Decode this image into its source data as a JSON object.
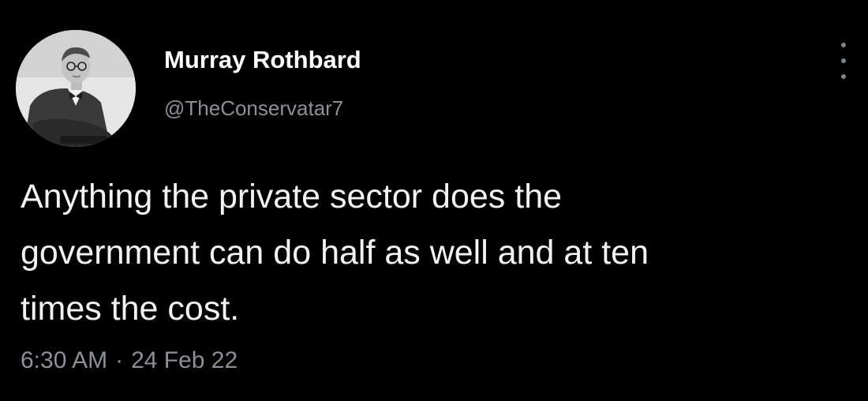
{
  "tweet": {
    "author": {
      "display_name": "Murray Rothbard",
      "handle": "@TheConservatar7",
      "avatar": "profile-photo-icon"
    },
    "more_icon": "more-vertical-icon",
    "text_lines": [
      "Anything the private sector does the",
      "government can do half as well and at ten",
      "times the cost."
    ],
    "time": "6:30 AM",
    "separator": "·",
    "date": "24 Feb 22"
  },
  "colors": {
    "background": "#000000",
    "primary_text": "#ffffff",
    "secondary_text": "#8b9196"
  }
}
